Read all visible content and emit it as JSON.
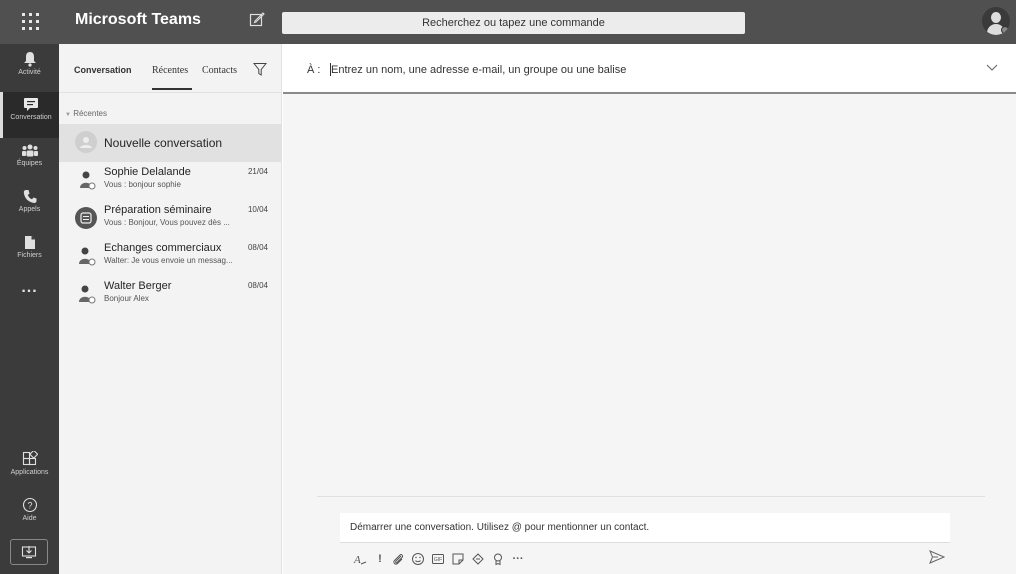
{
  "app": {
    "title": "Microsoft Teams"
  },
  "search": {
    "placeholder": "Recherchez ou tapez une commande"
  },
  "rail": {
    "items": [
      {
        "label": "Activité",
        "icon": "bell-icon"
      },
      {
        "label": "Conversation",
        "icon": "chat-icon"
      },
      {
        "label": "Équipes",
        "icon": "teams-icon"
      },
      {
        "label": "Appels",
        "icon": "phone-icon"
      },
      {
        "label": "Fichiers",
        "icon": "file-icon"
      },
      {
        "label": "...",
        "icon": "more-icon"
      },
      {
        "label": "Applications",
        "icon": "apps-icon"
      },
      {
        "label": "Aide",
        "icon": "help-icon"
      }
    ],
    "active": "Conversation"
  },
  "list": {
    "tabs": [
      "Conversation",
      "Récentes",
      "Contacts"
    ],
    "active_tab": "Récentes",
    "section_label": "Récentes",
    "new_conversation": "Nouvelle conversation",
    "conversations": [
      {
        "name": "Sophie Delalande",
        "preview": "Vous : bonjour sophie",
        "date": "21/04"
      },
      {
        "name": "Préparation séminaire",
        "preview": "Vous : Bonjour, Vous pouvez dès ...",
        "date": "10/04"
      },
      {
        "name": "Echanges commerciaux",
        "preview": "Walter: Je vous envoie un messag...",
        "date": "08/04"
      },
      {
        "name": "Walter Berger",
        "preview": "Bonjour Alex",
        "date": "08/04"
      }
    ]
  },
  "main": {
    "to_label": "À :",
    "to_placeholder": "Entrez un nom, une adresse e-mail, un groupe ou une balise",
    "compose_placeholder": "Démarrer une conversation. Utilisez @ pour mentionner un contact."
  },
  "colors": {
    "topbar": "#505050",
    "rail": "#3b3b3b",
    "list_bg": "#f3f3f3",
    "main_bg": "#f5f5f5"
  }
}
